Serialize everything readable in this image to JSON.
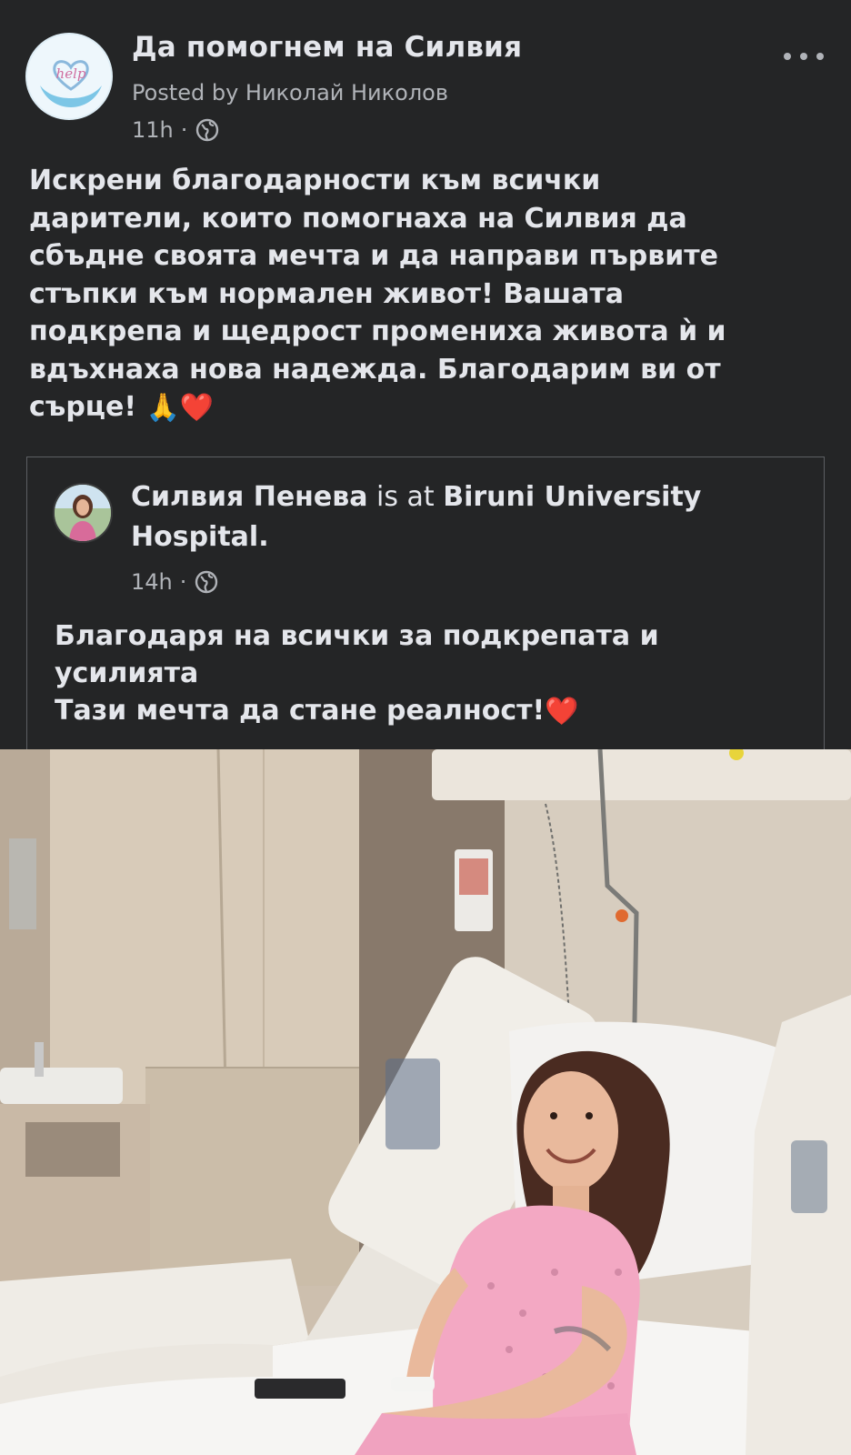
{
  "post": {
    "group_name": "Да помогнем на Силвия",
    "posted_by": "Posted by Николай Николов",
    "time": "11h",
    "separator": "·",
    "privacy_icon": "globe-icon",
    "more_icon": "more-options-icon",
    "body_lines": [
      "Искрени благодарности към всички",
      "дарители, които помогнаха на Силвия да",
      "сбъдне своята мечта и да направи първите",
      "стъпки към нормален живот! Вашата",
      "подкрепа и щедрост промениха живота ѝ и",
      "вдъхнаха нова надежда. Благодарим ви от",
      "сърце!"
    ],
    "body_emojis": [
      "🙏",
      "❤️"
    ]
  },
  "shared_post": {
    "author": "Силвия Пенева",
    "at_text": "is at",
    "place": "Biruni University Hospital.",
    "time": "14h",
    "separator": "·",
    "lines": [
      "Благодаря на всички за подкрепата и",
      "усилията",
      "Тази мечта да стане реалност!"
    ],
    "trailing_emoji": "❤️"
  },
  "photo": {
    "logo_text": "help"
  },
  "colors": {
    "background": "#242526",
    "text_primary": "#e4e6eb",
    "text_secondary": "#b0b3b8",
    "heart": "#e0245e",
    "shared_border": "#5d5f63"
  }
}
